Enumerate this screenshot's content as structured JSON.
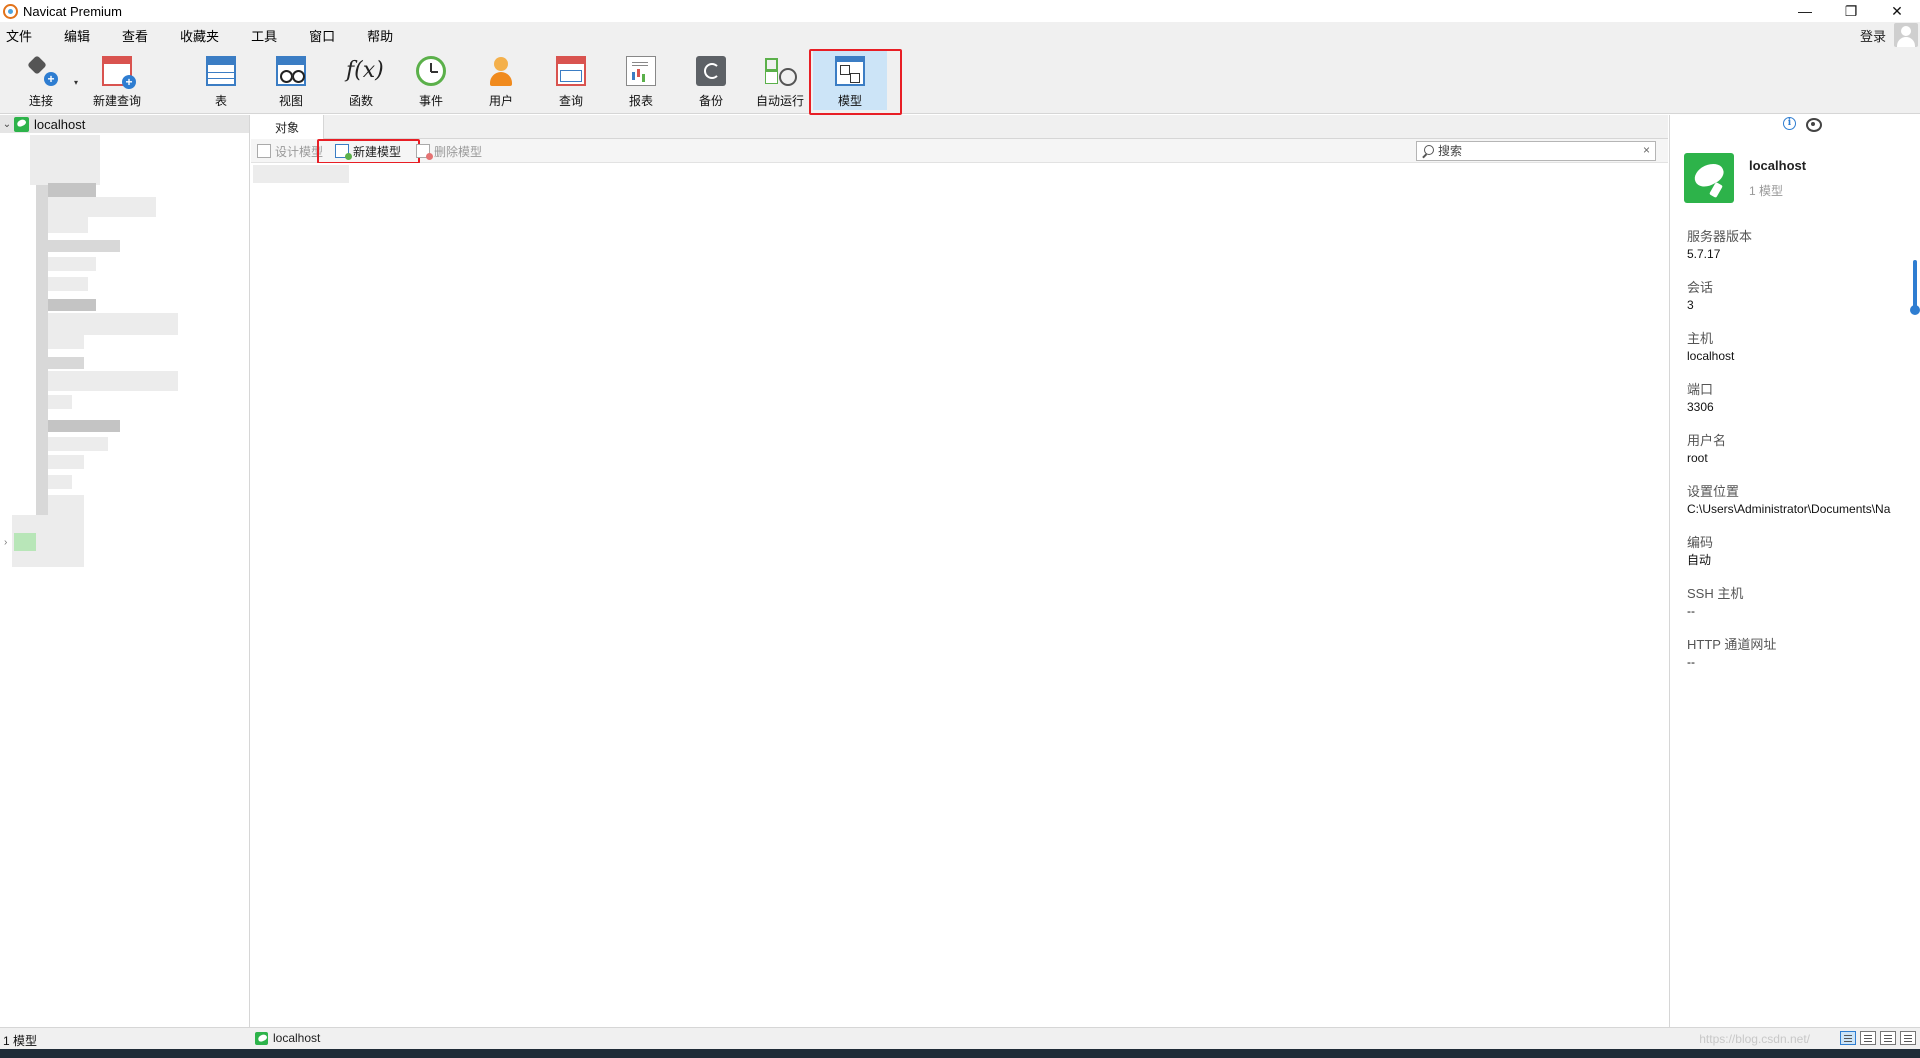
{
  "window": {
    "title": "Navicat Premium",
    "controls": {
      "minimize": "—",
      "restore": "❐",
      "close": "✕"
    }
  },
  "menu": {
    "items": [
      "文件",
      "编辑",
      "查看",
      "收藏夹",
      "工具",
      "窗口",
      "帮助"
    ],
    "login_label": "登录"
  },
  "toolbar": {
    "connect": "连接",
    "new_query": "新建查询",
    "table": "表",
    "view": "视图",
    "function": "函数",
    "function_glyph": "f(x)",
    "event": "事件",
    "user": "用户",
    "query": "查询",
    "report": "报表",
    "backup": "备份",
    "automation": "自动运行",
    "model": "模型",
    "active_item": "model"
  },
  "navigator": {
    "root_label": "localhost",
    "root_expanded": true
  },
  "object_pane": {
    "tab_label": "对象",
    "design_model": "设计模型",
    "new_model": "新建模型",
    "delete_model": "删除模型",
    "search_placeholder": "搜索",
    "search_clear": "×"
  },
  "info_panel": {
    "name": "localhost",
    "count": "1 模型",
    "fields": [
      {
        "label": "服务器版本",
        "value": "5.7.17"
      },
      {
        "label": "会话",
        "value": "3"
      },
      {
        "label": "主机",
        "value": "localhost"
      },
      {
        "label": "端口",
        "value": "3306"
      },
      {
        "label": "用户名",
        "value": "root"
      },
      {
        "label": "设置位置",
        "value": "C:\\Users\\Administrator\\Documents\\Na"
      },
      {
        "label": "编码",
        "value": "自动"
      },
      {
        "label": "SSH 主机",
        "value": "--"
      },
      {
        "label": "HTTP 通道网址",
        "value": "--"
      }
    ]
  },
  "statusbar": {
    "left_text": "1 模型",
    "connection": "localhost",
    "watermark": "https://blog.csdn.net/"
  },
  "colors": {
    "highlight": "#e81e25",
    "active_bg": "#cce4f7",
    "connection_green": "#2db34a",
    "accent_blue": "#2e7dd1"
  }
}
